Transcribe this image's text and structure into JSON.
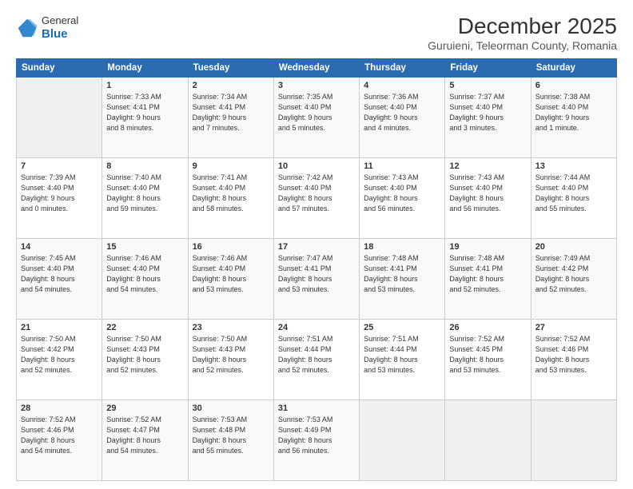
{
  "logo": {
    "general": "General",
    "blue": "Blue"
  },
  "title": "December 2025",
  "subtitle": "Guruieni, Teleorman County, Romania",
  "header_days": [
    "Sunday",
    "Monday",
    "Tuesday",
    "Wednesday",
    "Thursday",
    "Friday",
    "Saturday"
  ],
  "weeks": [
    [
      {
        "day": "",
        "info": ""
      },
      {
        "day": "1",
        "info": "Sunrise: 7:33 AM\nSunset: 4:41 PM\nDaylight: 9 hours\nand 8 minutes."
      },
      {
        "day": "2",
        "info": "Sunrise: 7:34 AM\nSunset: 4:41 PM\nDaylight: 9 hours\nand 7 minutes."
      },
      {
        "day": "3",
        "info": "Sunrise: 7:35 AM\nSunset: 4:40 PM\nDaylight: 9 hours\nand 5 minutes."
      },
      {
        "day": "4",
        "info": "Sunrise: 7:36 AM\nSunset: 4:40 PM\nDaylight: 9 hours\nand 4 minutes."
      },
      {
        "day": "5",
        "info": "Sunrise: 7:37 AM\nSunset: 4:40 PM\nDaylight: 9 hours\nand 3 minutes."
      },
      {
        "day": "6",
        "info": "Sunrise: 7:38 AM\nSunset: 4:40 PM\nDaylight: 9 hours\nand 1 minute."
      }
    ],
    [
      {
        "day": "7",
        "info": "Sunrise: 7:39 AM\nSunset: 4:40 PM\nDaylight: 9 hours\nand 0 minutes."
      },
      {
        "day": "8",
        "info": "Sunrise: 7:40 AM\nSunset: 4:40 PM\nDaylight: 8 hours\nand 59 minutes."
      },
      {
        "day": "9",
        "info": "Sunrise: 7:41 AM\nSunset: 4:40 PM\nDaylight: 8 hours\nand 58 minutes."
      },
      {
        "day": "10",
        "info": "Sunrise: 7:42 AM\nSunset: 4:40 PM\nDaylight: 8 hours\nand 57 minutes."
      },
      {
        "day": "11",
        "info": "Sunrise: 7:43 AM\nSunset: 4:40 PM\nDaylight: 8 hours\nand 56 minutes."
      },
      {
        "day": "12",
        "info": "Sunrise: 7:43 AM\nSunset: 4:40 PM\nDaylight: 8 hours\nand 56 minutes."
      },
      {
        "day": "13",
        "info": "Sunrise: 7:44 AM\nSunset: 4:40 PM\nDaylight: 8 hours\nand 55 minutes."
      }
    ],
    [
      {
        "day": "14",
        "info": "Sunrise: 7:45 AM\nSunset: 4:40 PM\nDaylight: 8 hours\nand 54 minutes."
      },
      {
        "day": "15",
        "info": "Sunrise: 7:46 AM\nSunset: 4:40 PM\nDaylight: 8 hours\nand 54 minutes."
      },
      {
        "day": "16",
        "info": "Sunrise: 7:46 AM\nSunset: 4:40 PM\nDaylight: 8 hours\nand 53 minutes."
      },
      {
        "day": "17",
        "info": "Sunrise: 7:47 AM\nSunset: 4:41 PM\nDaylight: 8 hours\nand 53 minutes."
      },
      {
        "day": "18",
        "info": "Sunrise: 7:48 AM\nSunset: 4:41 PM\nDaylight: 8 hours\nand 53 minutes."
      },
      {
        "day": "19",
        "info": "Sunrise: 7:48 AM\nSunset: 4:41 PM\nDaylight: 8 hours\nand 52 minutes."
      },
      {
        "day": "20",
        "info": "Sunrise: 7:49 AM\nSunset: 4:42 PM\nDaylight: 8 hours\nand 52 minutes."
      }
    ],
    [
      {
        "day": "21",
        "info": "Sunrise: 7:50 AM\nSunset: 4:42 PM\nDaylight: 8 hours\nand 52 minutes."
      },
      {
        "day": "22",
        "info": "Sunrise: 7:50 AM\nSunset: 4:43 PM\nDaylight: 8 hours\nand 52 minutes."
      },
      {
        "day": "23",
        "info": "Sunrise: 7:50 AM\nSunset: 4:43 PM\nDaylight: 8 hours\nand 52 minutes."
      },
      {
        "day": "24",
        "info": "Sunrise: 7:51 AM\nSunset: 4:44 PM\nDaylight: 8 hours\nand 52 minutes."
      },
      {
        "day": "25",
        "info": "Sunrise: 7:51 AM\nSunset: 4:44 PM\nDaylight: 8 hours\nand 53 minutes."
      },
      {
        "day": "26",
        "info": "Sunrise: 7:52 AM\nSunset: 4:45 PM\nDaylight: 8 hours\nand 53 minutes."
      },
      {
        "day": "27",
        "info": "Sunrise: 7:52 AM\nSunset: 4:46 PM\nDaylight: 8 hours\nand 53 minutes."
      }
    ],
    [
      {
        "day": "28",
        "info": "Sunrise: 7:52 AM\nSunset: 4:46 PM\nDaylight: 8 hours\nand 54 minutes."
      },
      {
        "day": "29",
        "info": "Sunrise: 7:52 AM\nSunset: 4:47 PM\nDaylight: 8 hours\nand 54 minutes."
      },
      {
        "day": "30",
        "info": "Sunrise: 7:53 AM\nSunset: 4:48 PM\nDaylight: 8 hours\nand 55 minutes."
      },
      {
        "day": "31",
        "info": "Sunrise: 7:53 AM\nSunset: 4:49 PM\nDaylight: 8 hours\nand 56 minutes."
      },
      {
        "day": "",
        "info": ""
      },
      {
        "day": "",
        "info": ""
      },
      {
        "day": "",
        "info": ""
      }
    ]
  ]
}
